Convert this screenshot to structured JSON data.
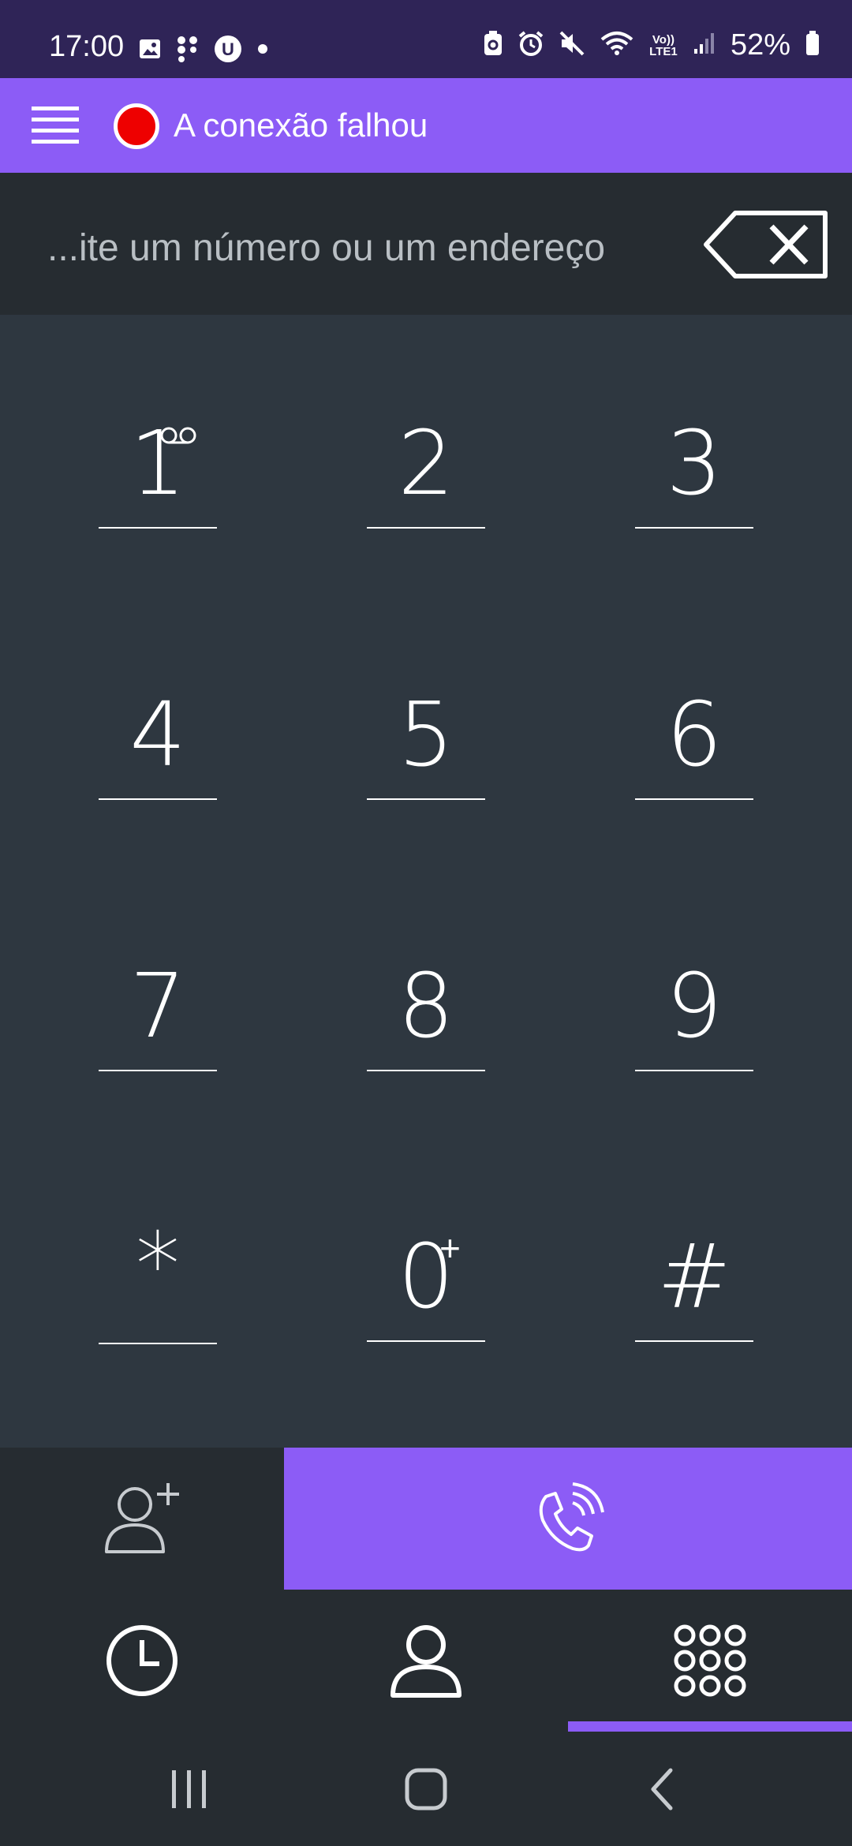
{
  "status_bar": {
    "time": "17:00",
    "battery": "52%",
    "left_icons": [
      "image-icon",
      "apps-grid-icon",
      "u-badge-icon",
      "dot-icon"
    ],
    "right_icons": [
      "battery-saver-icon",
      "alarm-icon",
      "mute-icon",
      "wifi-icon",
      "volte-lte-icon",
      "signal-icon",
      "battery-icon"
    ],
    "volte_label": "Vo)) LTE1"
  },
  "app_bar": {
    "connection_status": "A conexão falhou",
    "status_color": "#ee0000"
  },
  "dial_input": {
    "placeholder": "...ite um número ou um endereço",
    "value": ""
  },
  "keypad": {
    "keys": [
      {
        "digit": "1",
        "sup": "voicemail"
      },
      {
        "digit": "2",
        "sup": ""
      },
      {
        "digit": "3",
        "sup": ""
      },
      {
        "digit": "4",
        "sup": ""
      },
      {
        "digit": "5",
        "sup": ""
      },
      {
        "digit": "6",
        "sup": ""
      },
      {
        "digit": "7",
        "sup": ""
      },
      {
        "digit": "8",
        "sup": ""
      },
      {
        "digit": "9",
        "sup": ""
      },
      {
        "digit": "*",
        "sup": ""
      },
      {
        "digit": "0",
        "sup": "+"
      },
      {
        "digit": "#",
        "sup": ""
      }
    ]
  },
  "actions": {
    "add_contact_icon": "add-contact-icon",
    "call_icon": "phone-call-icon"
  },
  "tabs": [
    {
      "name": "history",
      "icon": "clock-icon"
    },
    {
      "name": "contacts",
      "icon": "person-icon"
    },
    {
      "name": "dialpad",
      "icon": "dialpad-icon",
      "active": true
    }
  ],
  "colors": {
    "accent": "#8c5cf6",
    "status_bar": "#2f2457",
    "background": "#2e3740",
    "panel": "#262c31"
  }
}
